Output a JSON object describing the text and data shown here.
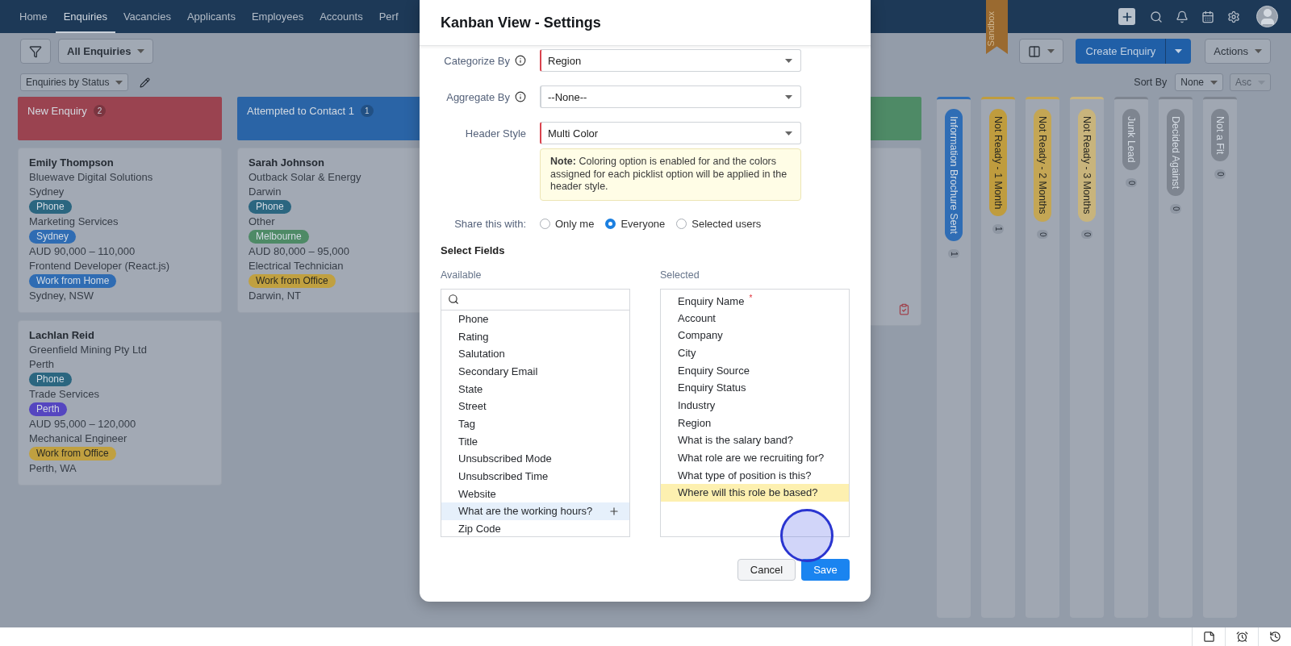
{
  "nav": {
    "items": [
      {
        "label": "Home",
        "selected": false
      },
      {
        "label": "Enquiries",
        "selected": true
      },
      {
        "label": "Vacancies",
        "selected": false
      },
      {
        "label": "Applicants",
        "selected": false
      },
      {
        "label": "Employees",
        "selected": false
      },
      {
        "label": "Accounts",
        "selected": false
      },
      {
        "label": "Perf",
        "selected": false
      }
    ]
  },
  "sandbox_ribbon": "Sandbox",
  "toolbar": {
    "view_filter": "All Enquiries",
    "create_button": "Create Enquiry",
    "actions_button": "Actions"
  },
  "subtoolbar": {
    "layout": "Enquiries by Status",
    "sort_label": "Sort By",
    "sort_field": "None",
    "sort_order": {
      "label": "Asc",
      "disabled": true
    }
  },
  "columns": [
    {
      "title": "New Enquiry",
      "count": "2",
      "color": "#9a4350",
      "cards": [
        {
          "kind": "record",
          "name": "Emily Thompson",
          "lines": [
            {
              "kind": "text",
              "text": "Bluewave Digital Solutions"
            },
            {
              "kind": "text",
              "text": "Sydney"
            },
            {
              "kind": "tag",
              "text": "Phone",
              "color": "#2b6680"
            },
            {
              "kind": "text",
              "text": "Marketing Services"
            },
            {
              "kind": "tag",
              "text": "Sydney",
              "color": "#2f6cb3"
            },
            {
              "kind": "text",
              "text": "AUD 90,000 – 110,000"
            },
            {
              "kind": "text",
              "text": "Frontend Developer (React.js)"
            },
            {
              "kind": "tag",
              "text": "Work from Home",
              "color": "#2f6cb3"
            },
            {
              "kind": "text",
              "text": "Sydney, NSW"
            }
          ]
        },
        {
          "kind": "record",
          "name": "Lachlan Reid",
          "lines": [
            {
              "kind": "text",
              "text": "Greenfield Mining Pty Ltd"
            },
            {
              "kind": "text",
              "text": "Perth"
            },
            {
              "kind": "tag",
              "text": "Phone",
              "color": "#2b6680"
            },
            {
              "kind": "text",
              "text": "Trade Services"
            },
            {
              "kind": "tag",
              "text": "Perth",
              "color": "#5546c0"
            },
            {
              "kind": "text",
              "text": "AUD 95,000 – 120,000"
            },
            {
              "kind": "text",
              "text": "Mechanical Engineer"
            },
            {
              "kind": "tag",
              "text": "Work from Office",
              "color": "#c0a040"
            },
            {
              "kind": "text",
              "text": "Perth, WA"
            }
          ]
        }
      ]
    },
    {
      "title": "Attempted to Contact 1",
      "count": "1",
      "color": "#2a64a6",
      "cards": [
        {
          "kind": "record",
          "name": "Sarah Johnson",
          "lines": [
            {
              "kind": "text",
              "text": "Outback Solar & Energy"
            },
            {
              "kind": "text",
              "text": "Darwin"
            },
            {
              "kind": "tag",
              "text": "Phone",
              "color": "#2b6680"
            },
            {
              "kind": "text",
              "text": "Other"
            },
            {
              "kind": "tag",
              "text": "Melbourne",
              "color": "#4e8a66"
            },
            {
              "kind": "text",
              "text": "AUD 80,000 – 95,000"
            },
            {
              "kind": "text",
              "text": "Electrical Technician"
            },
            {
              "kind": "tag",
              "text": "Work from Office",
              "color": "#c0a040"
            },
            {
              "kind": "text",
              "text": "Darwin, NT"
            }
          ]
        }
      ]
    },
    {
      "color": "#4e8a66",
      "cards": [
        {
          "kind": "covered"
        }
      ]
    }
  ],
  "collapsed_columns": [
    {
      "title": "Information Brochure Sent",
      "count": "1",
      "color": "#2f6db5"
    },
    {
      "title": "Not Ready - 1 Month",
      "count": "1",
      "color": "#bf9c3e"
    },
    {
      "title": "Not Ready - 2 Months",
      "count": "0",
      "color": "#c4a654"
    },
    {
      "title": "Not Ready - 3 Months",
      "count": "0",
      "color": "#c8b47c"
    },
    {
      "title": "Junk Lead",
      "count": "0",
      "color": "#7e8590"
    },
    {
      "title": "Decided Against",
      "count": "0",
      "color": "#7e8590"
    },
    {
      "title": "Not a Fit",
      "count": "0",
      "color": "#7e8590"
    }
  ],
  "modal": {
    "title": "Kanban View - Settings",
    "fields": [
      {
        "label": "Categorize By",
        "info": true,
        "value": "Region",
        "required": true
      },
      {
        "label": "Aggregate By",
        "info": true,
        "value": "--None--",
        "required": false
      },
      {
        "label": "Header Style",
        "info": false,
        "value": "Multi Color",
        "required": true
      }
    ],
    "note": "**Note:** Coloring option is enabled for and the colors assigned for each picklist option will be applied in the header style.",
    "share": {
      "label": "Share this with:",
      "options": [
        {
          "label": "Only me",
          "selected": false
        },
        {
          "label": "Everyone",
          "selected": true
        },
        {
          "label": "Selected users",
          "selected": false
        }
      ]
    },
    "select_fields": "Select Fields",
    "available": {
      "label": "Available",
      "items": [
        {
          "label": "Phone",
          "hovered": false
        },
        {
          "label": "Rating",
          "hovered": false
        },
        {
          "label": "Salutation",
          "hovered": false
        },
        {
          "label": "Secondary Email",
          "hovered": false
        },
        {
          "label": "State",
          "hovered": false
        },
        {
          "label": "Street",
          "hovered": false
        },
        {
          "label": "Tag",
          "hovered": false
        },
        {
          "label": "Title",
          "hovered": false
        },
        {
          "label": "Unsubscribed Mode",
          "hovered": false
        },
        {
          "label": "Unsubscribed Time",
          "hovered": false
        },
        {
          "label": "Website",
          "hovered": false
        },
        {
          "label": "What are the working hours?",
          "hovered": true
        },
        {
          "label": "Zip Code",
          "hovered": false
        }
      ]
    },
    "selected": {
      "label": "Selected",
      "items": [
        {
          "label": "Enquiry Name",
          "mark": "*",
          "highlighted": false
        },
        {
          "label": "Account",
          "highlighted": false
        },
        {
          "label": "Company",
          "highlighted": false
        },
        {
          "label": "City",
          "highlighted": false
        },
        {
          "label": "Enquiry Source",
          "highlighted": false
        },
        {
          "label": "Enquiry Status",
          "highlighted": false
        },
        {
          "label": "Industry",
          "highlighted": false
        },
        {
          "label": "Region",
          "highlighted": false
        },
        {
          "label": "What is the salary band?",
          "highlighted": false
        },
        {
          "label": "What role are we recruiting for?",
          "highlighted": false
        },
        {
          "label": "What type of position is this?",
          "highlighted": false
        },
        {
          "label": "Where will this role be based?",
          "highlighted": true
        }
      ]
    },
    "buttons": {
      "cancel": "Cancel",
      "save": "Save"
    }
  }
}
